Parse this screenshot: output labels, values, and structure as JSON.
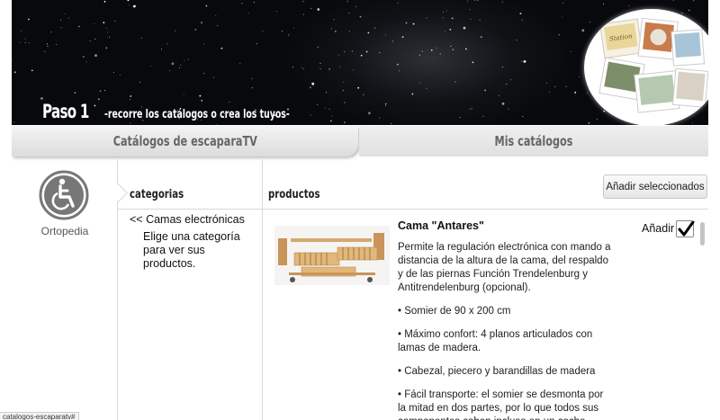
{
  "header": {
    "paso_title": "Paso 1",
    "paso_subtitle": "-recorre los catálogos o crea los tuyos-"
  },
  "tabs": [
    {
      "label": "Catálogos de escaparaTV",
      "active": true
    },
    {
      "label": "Mis catálogos",
      "active": false
    }
  ],
  "sidebar": {
    "category_icon": "wheelchair-icon",
    "category_label": "Ortopedia"
  },
  "categories": {
    "heading": "categorias",
    "back_link": "<< Camas electrónicas",
    "hint": "Elige una categoría para ver sus productos."
  },
  "products": {
    "heading": "productos",
    "add_selected_label": "Añadir seleccionados",
    "items": [
      {
        "name": "Cama \"Antares\"",
        "add_label": "Añadir",
        "checked": true,
        "description": [
          "Permite la regulación electrónica con mando a distancia de la altura de la cama, del respaldo y de las piernas Función Trendelenburg y Antitrendelenburg (opcional).",
          "• Somier de 90 x 200 cm",
          "• Máximo confort: 4 planos articulados con lamas de madera.",
          "• Cabezal, piecero y barandillas de madera",
          "• Fácil transporte: el somier se desmonta por la mitad en dos partes, por lo que todos sus componentes caben incluso en un coche."
        ]
      }
    ]
  },
  "status_bar": {
    "url_tooltip": "catalogos-escaparatv#"
  },
  "colors": {
    "banner_bg": "#07090c",
    "tab_text": "#666666",
    "divider": "#d8d8d8",
    "icon_gray": "#777777"
  }
}
